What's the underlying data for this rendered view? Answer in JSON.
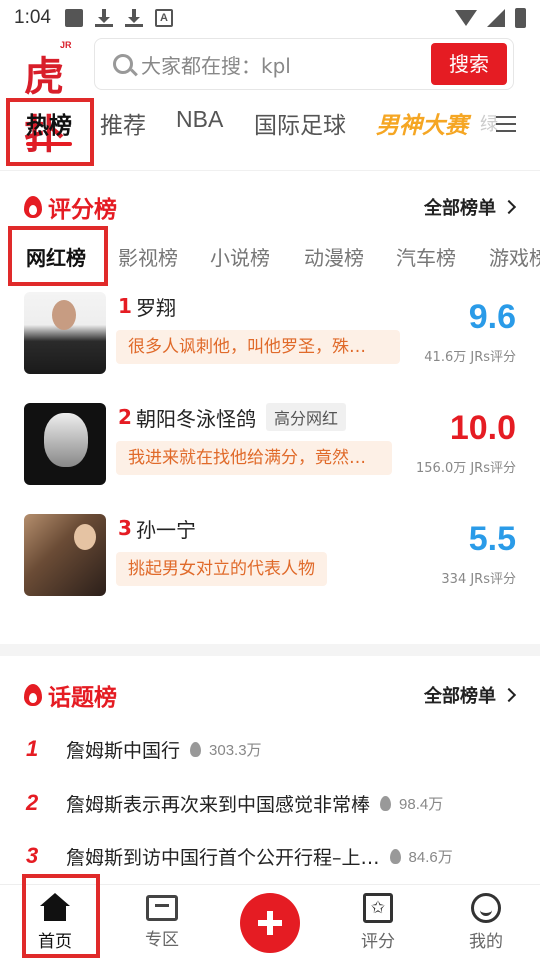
{
  "status_bar": {
    "time": "1:04",
    "notif_icon_letter": "A"
  },
  "header": {
    "logo_sup": "JR",
    "logo_text": "虎扑",
    "search_placeholder": "大家都在搜：kpl",
    "search_button": "搜索"
  },
  "top_tabs": [
    {
      "label": "热榜",
      "active": true
    },
    {
      "label": "推荐"
    },
    {
      "label": "NBA"
    },
    {
      "label": "国际足球"
    },
    {
      "label": "男神大赛",
      "special": true
    },
    {
      "label": "绿"
    }
  ],
  "rating_section": {
    "title": "评分榜",
    "all_link": "全部榜单",
    "sub_tabs": [
      "网红榜",
      "影视榜",
      "小说榜",
      "动漫榜",
      "汽车榜",
      "游戏榜"
    ],
    "items": [
      {
        "rank": "1",
        "name": "罗翔",
        "tag": "",
        "comment": "很多人讽刺他，叫他罗圣，殊…",
        "score": "9.6",
        "votes": "41.6万 JRs评分",
        "score_color": "#2a9be8"
      },
      {
        "rank": "2",
        "name": "朝阳冬泳怪鸽",
        "tag": "高分网红",
        "comment": "我进来就在找他给满分，竟然…",
        "score": "10.0",
        "votes": "156.0万 JRs评分",
        "score_color": "#e51c23"
      },
      {
        "rank": "3",
        "name": "孙一宁",
        "tag": "",
        "comment": "挑起男女对立的代表人物",
        "score": "5.5",
        "votes": "334 JRs评分",
        "score_color": "#2a9be8"
      }
    ]
  },
  "topic_section": {
    "title": "话题榜",
    "all_link": "全部榜单",
    "items": [
      {
        "rank": "1",
        "title": "詹姆斯中国行",
        "hot": "303.3万"
      },
      {
        "rank": "2",
        "title": "詹姆斯表示再次来到中国感觉非常棒",
        "hot": "98.4万"
      },
      {
        "rank": "3",
        "title": "詹姆斯到访中国行首个公开行程–上…",
        "hot": "84.6万"
      }
    ]
  },
  "bottom_nav": {
    "home": "首页",
    "zone": "专区",
    "rate": "评分",
    "me": "我的",
    "rate_glyph": "✩"
  },
  "colors": {
    "brand_red": "#e51c23",
    "score_blue": "#2a9be8",
    "comment_bg": "#fdf0e6"
  }
}
